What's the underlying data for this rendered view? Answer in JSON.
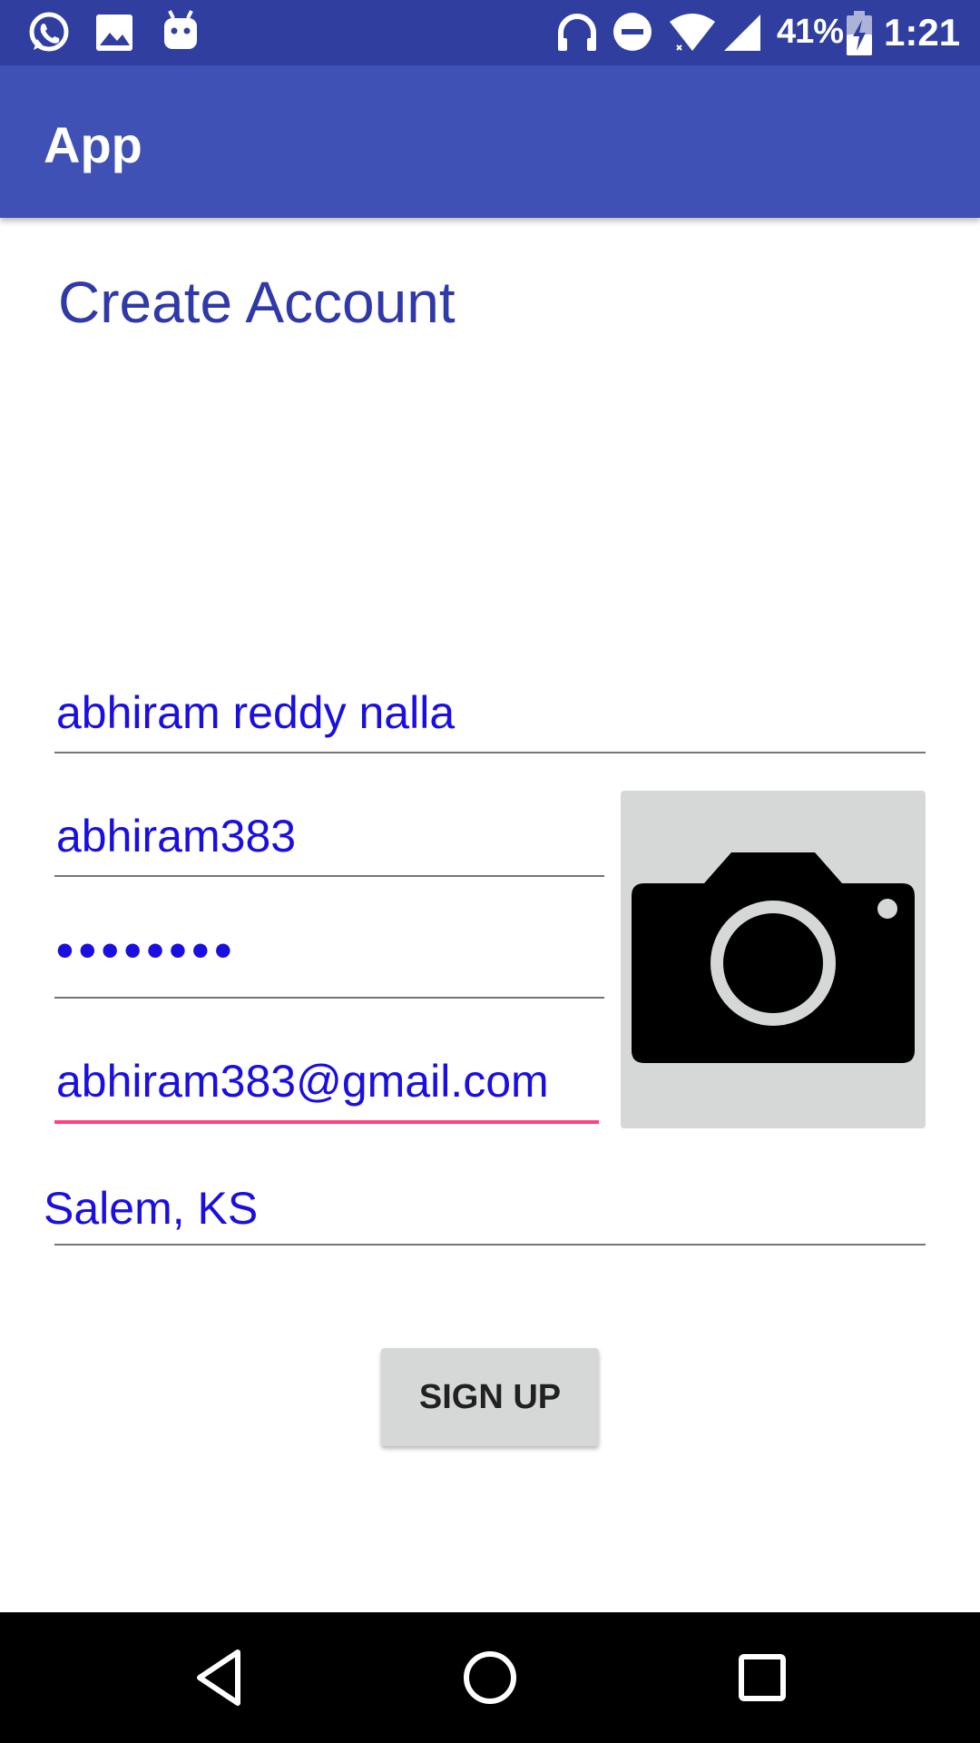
{
  "status_bar": {
    "battery_percent": "41%",
    "time": "1:21",
    "icons": [
      "whatsapp-icon",
      "image-icon",
      "android-icon",
      "headphones-icon",
      "do-not-disturb-icon",
      "wifi-icon",
      "cellular-signal-icon",
      "battery-charging-icon"
    ]
  },
  "app_bar": {
    "title": "App"
  },
  "form": {
    "heading": "Create Account",
    "full_name": "abhiram reddy nalla",
    "username": "abhiram383",
    "password_masked": "••••••••",
    "email": "abhiram383@gmail.com",
    "location": "Salem, KS",
    "photo_icon": "camera-icon",
    "signup_label": "SIGN UP"
  },
  "nav_bar": {
    "buttons": [
      "back-icon",
      "home-icon",
      "recents-icon"
    ]
  },
  "colors": {
    "status_bar": "#303f9f",
    "app_bar": "#3f51b5",
    "heading": "#3039a8",
    "input_text": "#1a0fe0",
    "focus_underline": "#ff4081",
    "button_bg": "#d6d7d7"
  }
}
